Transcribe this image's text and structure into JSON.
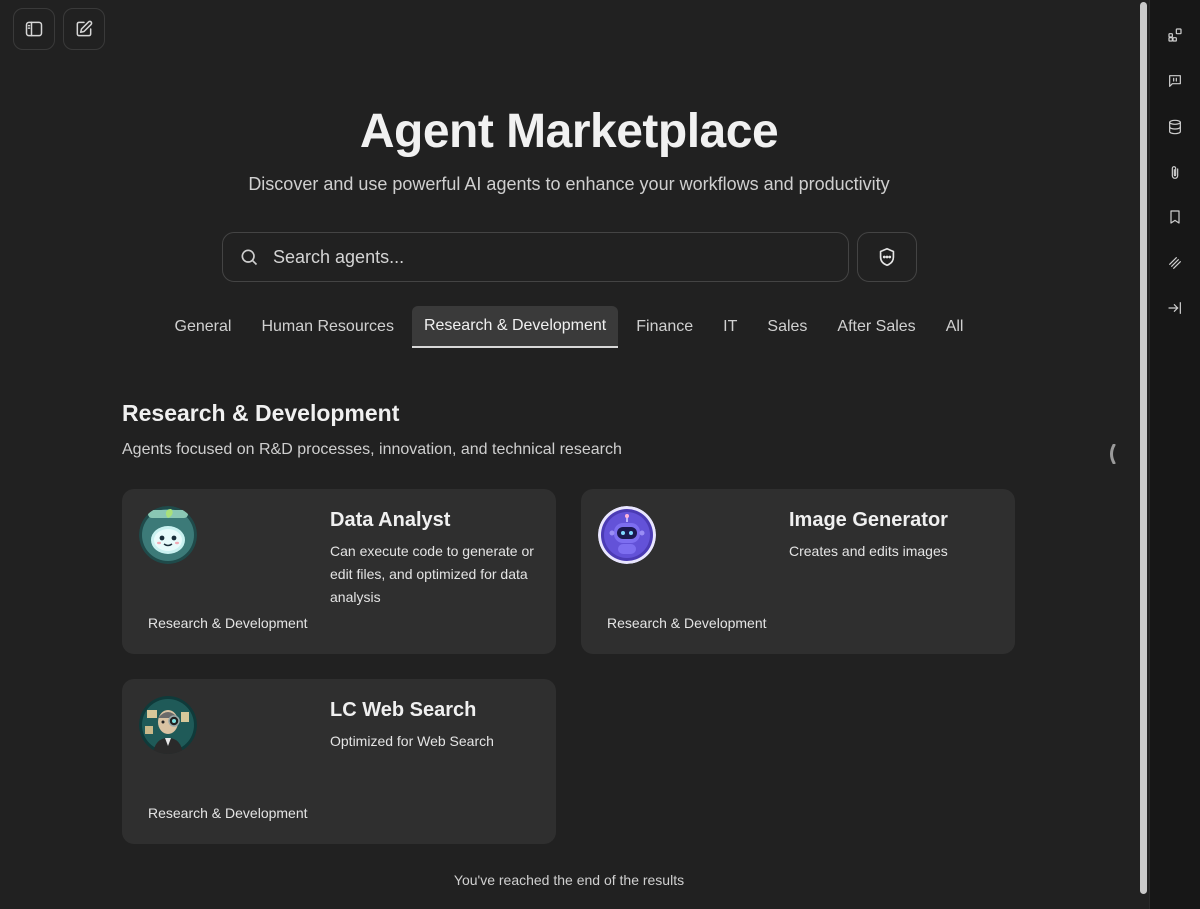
{
  "header": {
    "title": "Agent Marketplace",
    "subtitle": "Discover and use powerful AI agents to enhance your workflows and productivity"
  },
  "search": {
    "placeholder": "Search agents...",
    "value": ""
  },
  "tabs": [
    {
      "label": "General",
      "active": false
    },
    {
      "label": "Human Resources",
      "active": false
    },
    {
      "label": "Research & Development",
      "active": true
    },
    {
      "label": "Finance",
      "active": false
    },
    {
      "label": "IT",
      "active": false
    },
    {
      "label": "Sales",
      "active": false
    },
    {
      "label": "After Sales",
      "active": false
    },
    {
      "label": "All",
      "active": false
    }
  ],
  "section": {
    "title": "Research & Development",
    "description": "Agents focused on R&D processes, innovation, and technical research"
  },
  "agents": [
    {
      "name": "Data Analyst",
      "description": "Can execute code to generate or edit files, and optimized for data analysis",
      "category": "Research & Development",
      "avatar_icon": "leaf-mascot-avatar"
    },
    {
      "name": "Image Generator",
      "description": "Creates and edits images",
      "category": "Research & Development",
      "avatar_icon": "robot-avatar"
    },
    {
      "name": "LC Web Search",
      "description": "Optimized for Web Search",
      "category": "Research & Development",
      "avatar_icon": "cyborg-avatar"
    }
  ],
  "footer": {
    "end_text": "You've reached the end of the results"
  },
  "colors": {
    "background": "#212121",
    "card": "#2f2f2f",
    "side_panel": "#171717",
    "active_tab": "#3a3a3a"
  }
}
